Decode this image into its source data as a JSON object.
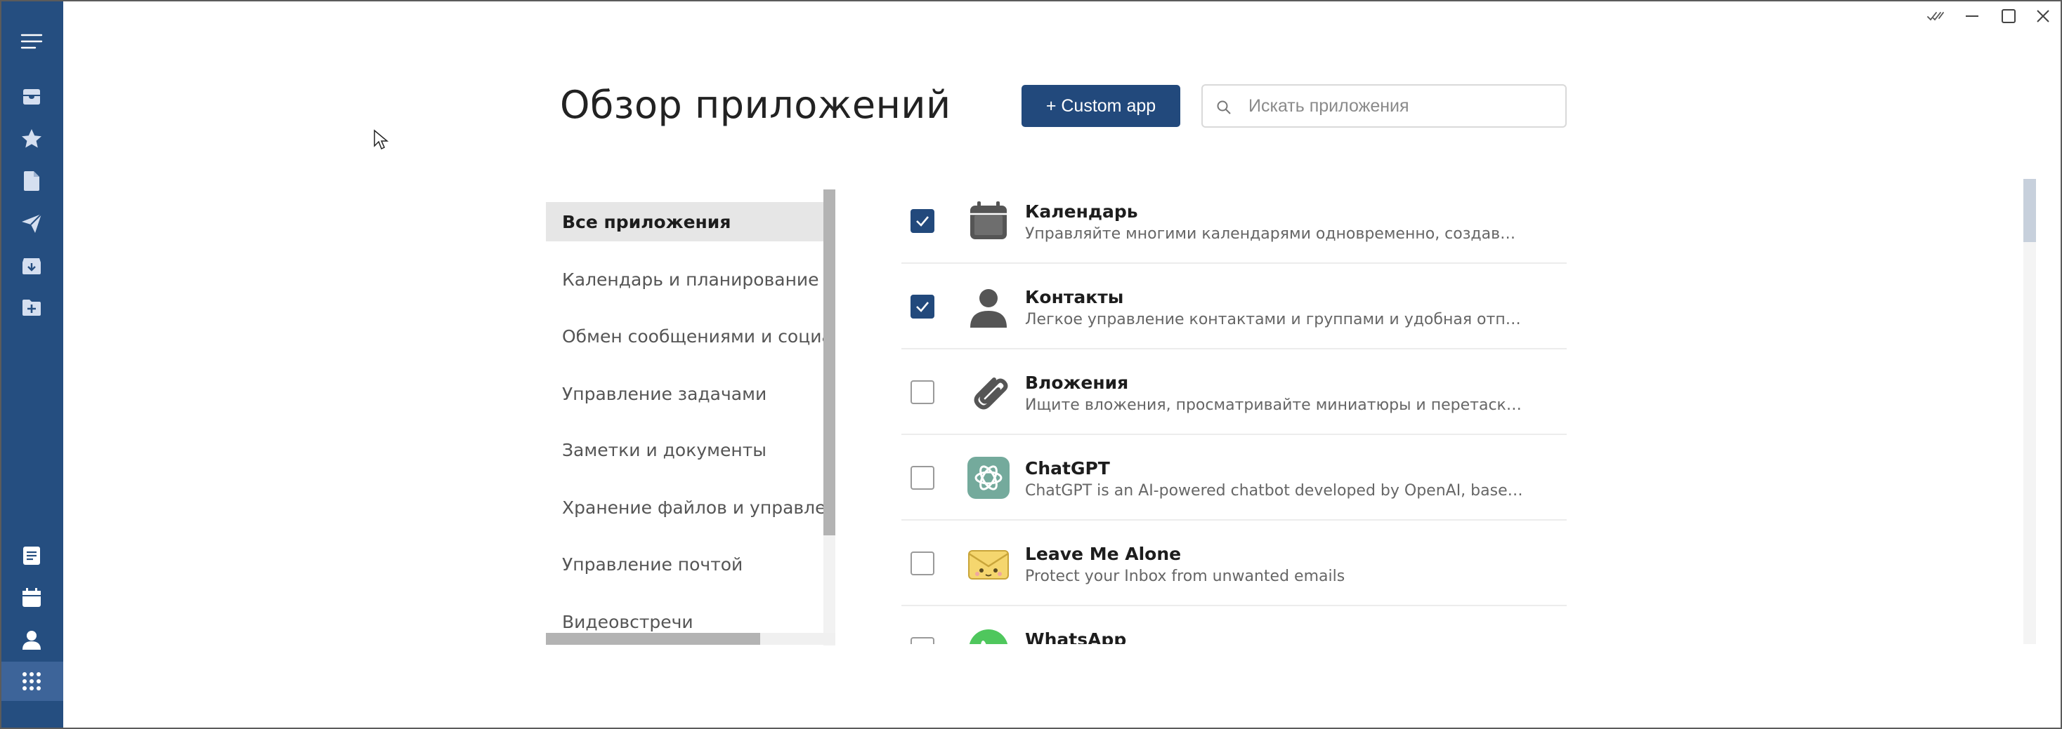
{
  "header": {
    "title": "Обзор приложений",
    "custom_app_label": "+ Custom app",
    "search_placeholder": "Искать приложения"
  },
  "rail": {
    "top_icons": [
      "menu-icon",
      "inbox-icon",
      "star-icon",
      "document-icon",
      "send-icon",
      "archive-icon",
      "folder-add-icon"
    ],
    "bottom_icons": [
      "notes-icon",
      "calendar-icon",
      "contacts-icon",
      "apps-grid-icon"
    ],
    "active": "apps-grid-icon"
  },
  "window_controls": [
    "read-all-icon",
    "minimize-icon",
    "maximize-icon",
    "close-icon"
  ],
  "categories": [
    {
      "label": "Все приложения",
      "selected": true
    },
    {
      "label": "Календарь и планирование"
    },
    {
      "label": "Обмен сообщениями и социальн"
    },
    {
      "label": "Управление задачами"
    },
    {
      "label": "Заметки и документы"
    },
    {
      "label": "Хранение файлов и управление и"
    },
    {
      "label": "Управление почтой"
    },
    {
      "label": "Видеовстречи"
    }
  ],
  "apps": [
    {
      "name": "Календарь",
      "description": "Управляйте многими календарями одновременно, создавайте соб…",
      "checked": true,
      "icon": "calendar-app-icon"
    },
    {
      "name": "Контакты",
      "description": "Легкое управление контактами и группами и удобная отправка пи…",
      "checked": true,
      "icon": "contacts-app-icon"
    },
    {
      "name": "Вложения",
      "description": "Ищите вложения, просматривайте миниатюры и перетаскивайте…",
      "checked": false,
      "icon": "paperclip-icon"
    },
    {
      "name": "ChatGPT",
      "description": "ChatGPT is an AI-powered chatbot developed by OpenAI, based on t…",
      "checked": false,
      "icon": "chatgpt-icon"
    },
    {
      "name": "Leave Me Alone",
      "description": "Protect your Inbox from unwanted emails",
      "checked": false,
      "icon": "envelope-face-icon"
    },
    {
      "name": "WhatsApp",
      "description": "",
      "checked": false,
      "icon": "whatsapp-icon"
    }
  ],
  "colors": {
    "rail": "#254e80",
    "accent": "#22497c",
    "selected_category_bg": "#e6e6e6"
  }
}
